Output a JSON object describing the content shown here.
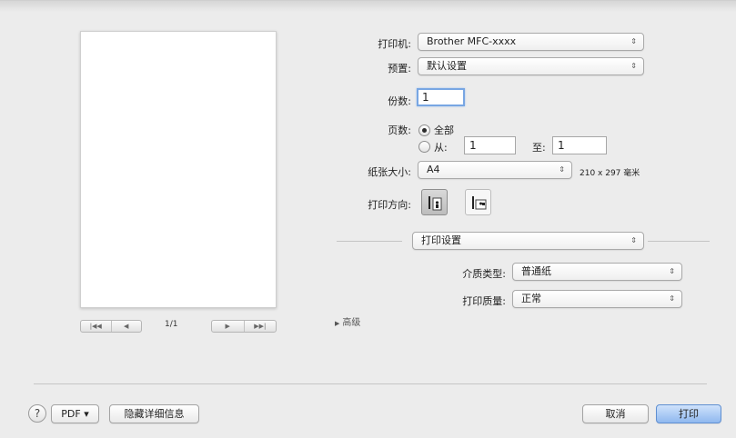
{
  "printer": {
    "label": "打印机:",
    "value": "Brother MFC-xxxx"
  },
  "presets": {
    "label": "预置:",
    "value": "默认设置"
  },
  "copies": {
    "label": "份数:",
    "value": "1"
  },
  "pages": {
    "label": "页数:",
    "all_label": "全部",
    "from_label": "从:",
    "from_value": "1",
    "to_label": "至:",
    "to_value": "1",
    "selected": "all"
  },
  "paper_size": {
    "label": "纸张大小:",
    "value": "A4",
    "dimensions": "210 x 297 毫米"
  },
  "orientation": {
    "label": "打印方向:",
    "selected": "portrait"
  },
  "section": {
    "value": "打印设置"
  },
  "media_type": {
    "label": "介质类型:",
    "value": "普通纸"
  },
  "print_quality": {
    "label": "打印质量:",
    "value": "正常"
  },
  "advanced": {
    "label": "高级"
  },
  "preview": {
    "page_count": "1/1"
  },
  "footer": {
    "help": "?",
    "pdf": "PDF ▾",
    "hide_details": "隐藏详细信息",
    "cancel": "取消",
    "print": "打印"
  },
  "icons": {
    "popup_arrows": "⇕",
    "first_page": "|◀◀",
    "prev_page": "◀",
    "next_page": "▶",
    "last_page": "▶▶|",
    "disclosure": "▶"
  }
}
